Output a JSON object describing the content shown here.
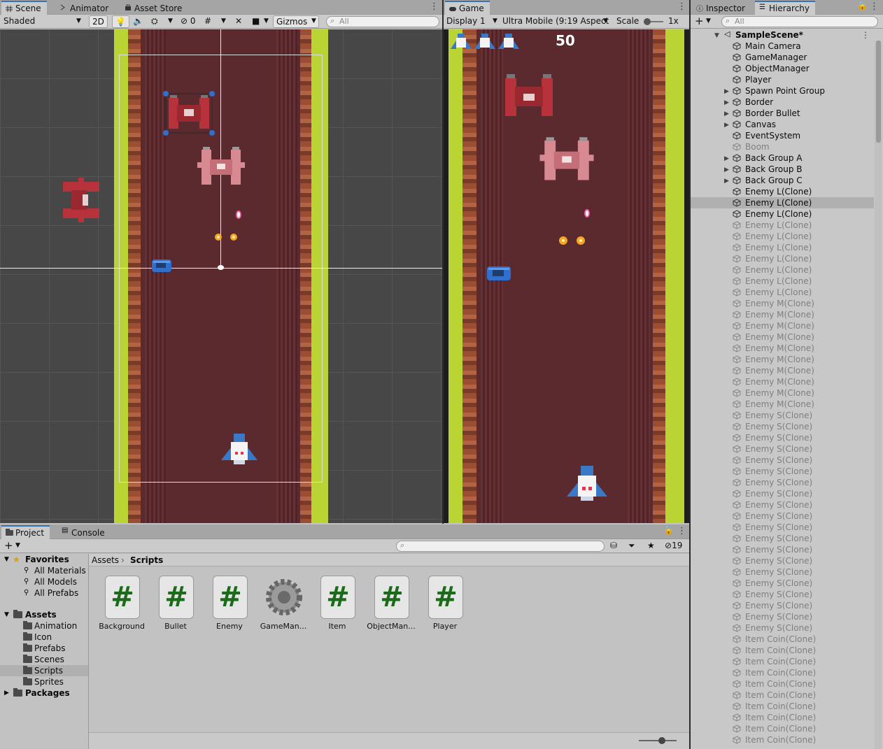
{
  "scene_panel": {
    "tabs": [
      {
        "label": "Scene",
        "icon": "grid-icon"
      },
      {
        "label": "Animator",
        "icon": "animator-icon"
      },
      {
        "label": "Asset Store",
        "icon": "store-icon"
      }
    ],
    "draw_mode": "Shaded",
    "mode_2d": "2D",
    "hidden_count": "0",
    "gizmos": "Gizmos",
    "search_placeholder": "All"
  },
  "game_panel": {
    "tab": "Game",
    "display": "Display 1",
    "aspect": "Ultra Mobile (9:19 Aspect)",
    "scale_label": "Scale",
    "scale_value": "1x",
    "score": "50",
    "lives": 3
  },
  "inspector_tab": "Inspector",
  "hierarchy": {
    "tab": "Hierarchy",
    "search_placeholder": "All",
    "scene_name": "SampleScene*",
    "items": [
      {
        "label": "Main Camera",
        "expandable": false,
        "active": true
      },
      {
        "label": "GameManager",
        "expandable": false,
        "active": true
      },
      {
        "label": "ObjectManager",
        "expandable": false,
        "active": true
      },
      {
        "label": "Player",
        "expandable": false,
        "active": true
      },
      {
        "label": "Spawn Point Group",
        "expandable": true,
        "active": true
      },
      {
        "label": "Border",
        "expandable": true,
        "active": true
      },
      {
        "label": "Border Bullet",
        "expandable": true,
        "active": true
      },
      {
        "label": "Canvas",
        "expandable": true,
        "active": true
      },
      {
        "label": "EventSystem",
        "expandable": false,
        "active": true
      },
      {
        "label": "Boom",
        "expandable": false,
        "active": false
      },
      {
        "label": "Back Group A",
        "expandable": true,
        "active": true
      },
      {
        "label": "Back Group B",
        "expandable": true,
        "active": true
      },
      {
        "label": "Back Group C",
        "expandable": true,
        "active": true
      },
      {
        "label": "Enemy L(Clone)",
        "expandable": false,
        "active": true
      },
      {
        "label": "Enemy L(Clone)",
        "expandable": false,
        "active": true,
        "selected": true
      },
      {
        "label": "Enemy L(Clone)",
        "expandable": false,
        "active": true
      },
      {
        "label": "Enemy L(Clone)",
        "expandable": false,
        "active": false
      },
      {
        "label": "Enemy L(Clone)",
        "expandable": false,
        "active": false
      },
      {
        "label": "Enemy L(Clone)",
        "expandable": false,
        "active": false
      },
      {
        "label": "Enemy L(Clone)",
        "expandable": false,
        "active": false
      },
      {
        "label": "Enemy L(Clone)",
        "expandable": false,
        "active": false
      },
      {
        "label": "Enemy L(Clone)",
        "expandable": false,
        "active": false
      },
      {
        "label": "Enemy L(Clone)",
        "expandable": false,
        "active": false
      },
      {
        "label": "Enemy M(Clone)",
        "expandable": false,
        "active": false
      },
      {
        "label": "Enemy M(Clone)",
        "expandable": false,
        "active": false
      },
      {
        "label": "Enemy M(Clone)",
        "expandable": false,
        "active": false
      },
      {
        "label": "Enemy M(Clone)",
        "expandable": false,
        "active": false
      },
      {
        "label": "Enemy M(Clone)",
        "expandable": false,
        "active": false
      },
      {
        "label": "Enemy M(Clone)",
        "expandable": false,
        "active": false
      },
      {
        "label": "Enemy M(Clone)",
        "expandable": false,
        "active": false
      },
      {
        "label": "Enemy M(Clone)",
        "expandable": false,
        "active": false
      },
      {
        "label": "Enemy M(Clone)",
        "expandable": false,
        "active": false
      },
      {
        "label": "Enemy M(Clone)",
        "expandable": false,
        "active": false
      },
      {
        "label": "Enemy S(Clone)",
        "expandable": false,
        "active": false
      },
      {
        "label": "Enemy S(Clone)",
        "expandable": false,
        "active": false
      },
      {
        "label": "Enemy S(Clone)",
        "expandable": false,
        "active": false
      },
      {
        "label": "Enemy S(Clone)",
        "expandable": false,
        "active": false
      },
      {
        "label": "Enemy S(Clone)",
        "expandable": false,
        "active": false
      },
      {
        "label": "Enemy S(Clone)",
        "expandable": false,
        "active": false
      },
      {
        "label": "Enemy S(Clone)",
        "expandable": false,
        "active": false
      },
      {
        "label": "Enemy S(Clone)",
        "expandable": false,
        "active": false
      },
      {
        "label": "Enemy S(Clone)",
        "expandable": false,
        "active": false
      },
      {
        "label": "Enemy S(Clone)",
        "expandable": false,
        "active": false
      },
      {
        "label": "Enemy S(Clone)",
        "expandable": false,
        "active": false
      },
      {
        "label": "Enemy S(Clone)",
        "expandable": false,
        "active": false
      },
      {
        "label": "Enemy S(Clone)",
        "expandable": false,
        "active": false
      },
      {
        "label": "Enemy S(Clone)",
        "expandable": false,
        "active": false
      },
      {
        "label": "Enemy S(Clone)",
        "expandable": false,
        "active": false
      },
      {
        "label": "Enemy S(Clone)",
        "expandable": false,
        "active": false
      },
      {
        "label": "Enemy S(Clone)",
        "expandable": false,
        "active": false
      },
      {
        "label": "Enemy S(Clone)",
        "expandable": false,
        "active": false
      },
      {
        "label": "Enemy S(Clone)",
        "expandable": false,
        "active": false
      },
      {
        "label": "Enemy S(Clone)",
        "expandable": false,
        "active": false
      },
      {
        "label": "Item Coin(Clone)",
        "expandable": false,
        "active": false
      },
      {
        "label": "Item Coin(Clone)",
        "expandable": false,
        "active": false
      },
      {
        "label": "Item Coin(Clone)",
        "expandable": false,
        "active": false
      },
      {
        "label": "Item Coin(Clone)",
        "expandable": false,
        "active": false
      },
      {
        "label": "Item Coin(Clone)",
        "expandable": false,
        "active": false
      },
      {
        "label": "Item Coin(Clone)",
        "expandable": false,
        "active": false
      },
      {
        "label": "Item Coin(Clone)",
        "expandable": false,
        "active": false
      },
      {
        "label": "Item Coin(Clone)",
        "expandable": false,
        "active": false
      },
      {
        "label": "Item Coin(Clone)",
        "expandable": false,
        "active": false
      },
      {
        "label": "Item Coin(Clone)",
        "expandable": false,
        "active": false
      }
    ]
  },
  "project": {
    "tabs": [
      "Project",
      "Console"
    ],
    "hidden_count": "19",
    "breadcrumb": [
      "Assets",
      "Scripts"
    ],
    "favorites": {
      "label": "Favorites",
      "items": [
        "All Materials",
        "All Models",
        "All Prefabs"
      ]
    },
    "assets": {
      "label": "Assets",
      "items": [
        "Animation",
        "Icon",
        "Prefabs",
        "Scenes",
        "Scripts",
        "Sprites"
      ],
      "selected": "Scripts"
    },
    "packages": "Packages",
    "files": [
      {
        "name": "Background",
        "icon": "csharp-script-icon"
      },
      {
        "name": "Bullet",
        "icon": "csharp-script-icon"
      },
      {
        "name": "Enemy",
        "icon": "csharp-script-icon"
      },
      {
        "name": "GameMan...",
        "icon": "gear-icon"
      },
      {
        "name": "Item",
        "icon": "csharp-script-icon"
      },
      {
        "name": "ObjectMan...",
        "icon": "csharp-script-icon"
      },
      {
        "name": "Player",
        "icon": "csharp-script-icon"
      }
    ]
  },
  "colors": {
    "accent": "#3a72b0",
    "road": "#5a2a2e",
    "grass": "#b9d433",
    "enemy": "#b8323c",
    "player": "#3a78c8"
  }
}
